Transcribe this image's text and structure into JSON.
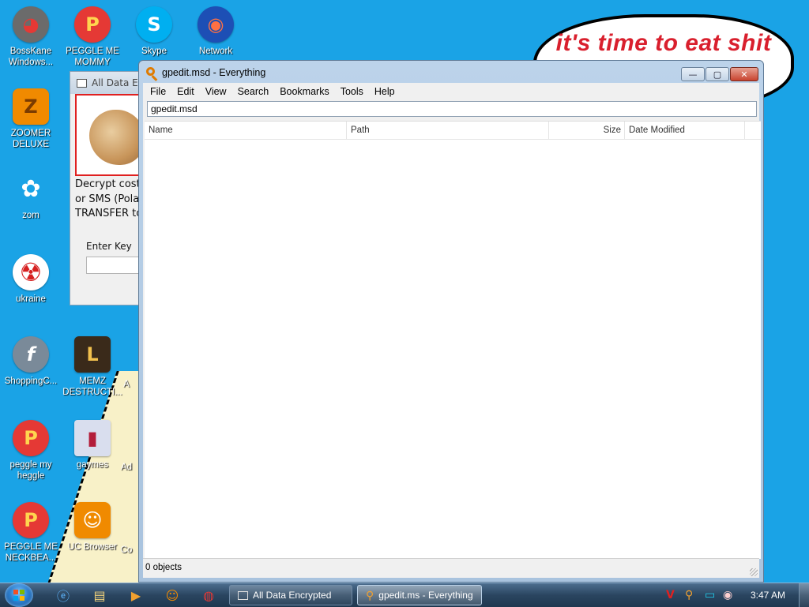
{
  "desktop": {
    "speech_text": "it's time to eat shit",
    "icons": [
      {
        "label": "BossKane Windows...",
        "glyph": "◕",
        "color": "#6b6b6b"
      },
      {
        "label": "PEGGLE ME MOMMY",
        "glyph": "P",
        "color": "#e53935"
      },
      {
        "label": "Skype",
        "glyph": "S",
        "color": "#00aff0"
      },
      {
        "label": "Network",
        "glyph": "◉",
        "color": "#1d4fb5"
      },
      {
        "label": "ZOOMER DELUXE",
        "glyph": "Z",
        "color": "#f08a00"
      },
      {
        "label": "zom",
        "glyph": "✿",
        "color": "#f4f4f4"
      },
      {
        "label": "ukraine",
        "glyph": "☢",
        "color": "#d62020"
      },
      {
        "label": "ShoppingC...",
        "glyph": "f",
        "color": "#7a8a99"
      },
      {
        "label": "MEMZ DESTRUCTI...",
        "glyph": "L",
        "color": "#c8a040"
      },
      {
        "label": "peggle my heggle",
        "glyph": "P",
        "color": "#e53935"
      },
      {
        "label": "gaymes",
        "glyph": "▮",
        "color": "#9aa7c8"
      },
      {
        "label": "PEGGLE ME NECKBEA...",
        "glyph": "P",
        "color": "#e53935"
      },
      {
        "label": "UC Browser",
        "glyph": "☺",
        "color": "#f08a00"
      }
    ],
    "partial_labels": {
      "e_label": "E",
      "a1": "A",
      "ad": "Ad",
      "co": "Co"
    }
  },
  "ade_window": {
    "title": "All Data En",
    "body_lines": [
      "Decrypt cost",
      "or SMS (Pola",
      "TRANSFER to"
    ],
    "enter_key_label": "Enter Key"
  },
  "everything": {
    "title": "gpedit.msd - Everything",
    "menu": [
      "File",
      "Edit",
      "View",
      "Search",
      "Bookmarks",
      "Tools",
      "Help"
    ],
    "search_value": "gpedit.msd",
    "columns": {
      "name": "Name",
      "path": "Path",
      "size": "Size",
      "date": "Date Modified"
    },
    "status": "0 objects",
    "caption": {
      "min": "—",
      "max": "▢",
      "close": "✕"
    }
  },
  "taskbar": {
    "tasks": [
      {
        "label": "All Data Encrypted"
      },
      {
        "label": "gpedit.ms - Everything"
      }
    ],
    "clock": "3:47 AM"
  },
  "colors": {
    "desktop": "#1aa3e6",
    "speech_text": "#d91f2d",
    "accent": "#e07b00"
  }
}
